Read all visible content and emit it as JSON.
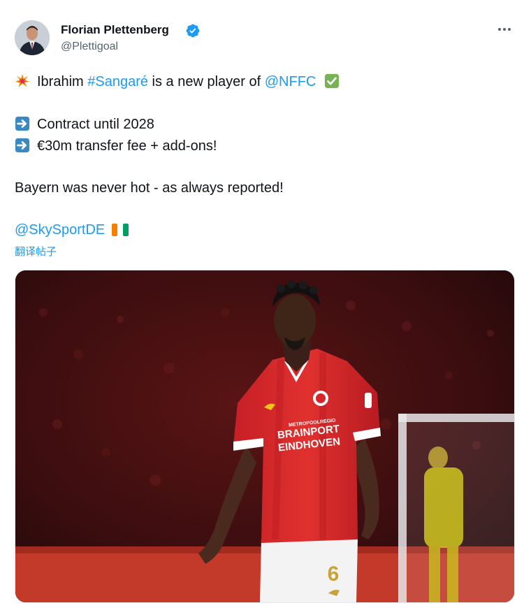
{
  "author": {
    "name": "Florian Plettenberg",
    "handle": "@Plettigoal",
    "verified": true
  },
  "tweet": {
    "line1": {
      "emoji": "collision-icon",
      "prefix": "Ibrahim ",
      "hashtag": "#Sangaré",
      "middle": " is a new player of ",
      "mention": "@NFFC",
      "suffix_emoji": "check-mark-icon"
    },
    "line2": "Contract until 2028",
    "line3": "€30m transfer fee + add-ons!",
    "line4": "Bayern was never hot - as always reported!",
    "line5": {
      "mention": "@SkySportDE",
      "flag": "ivory-coast-flag-icon"
    },
    "translate_label": "翻译帖子"
  },
  "media": {
    "shirt_sponsor_top": "METROPOOLREGIO",
    "shirt_sponsor_line1": "BRAINPORT",
    "shirt_sponsor_line2": "EINDHOVEN",
    "shirt_number": "6",
    "colors": {
      "shirt": "#d7262a",
      "crowd": "#4a1212",
      "goalkeeper": "#d8d020",
      "board": "#c43a2a"
    }
  },
  "colors": {
    "link": "#1d9bf0",
    "text": "#0f1419",
    "muted": "#536471",
    "verified": "#1d9bf0",
    "arrow_box": "#3b88c3"
  }
}
